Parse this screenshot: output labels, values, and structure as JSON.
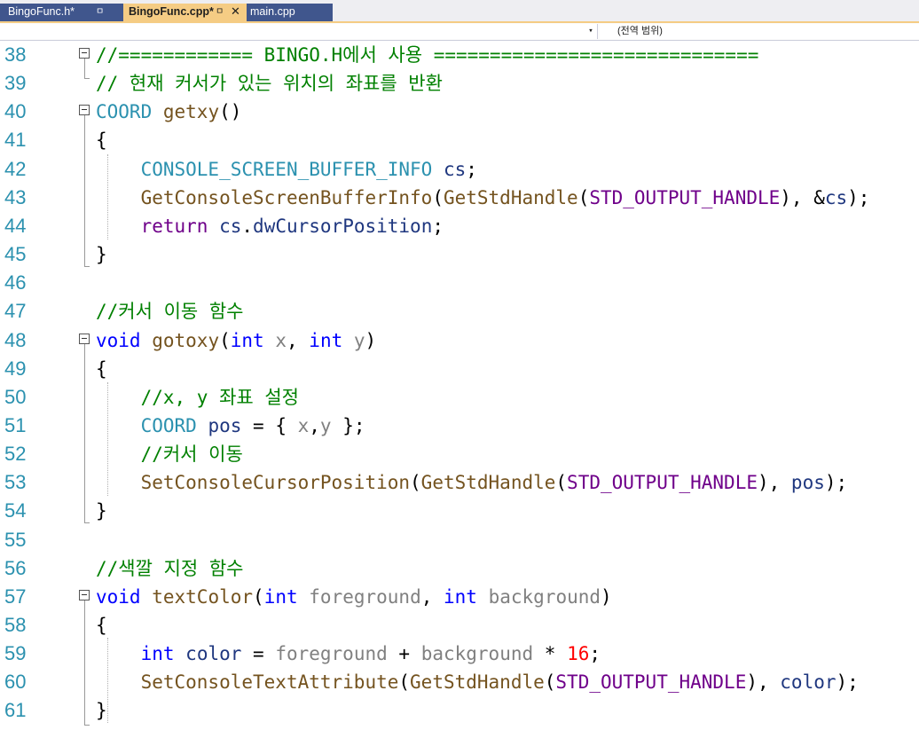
{
  "tabs": [
    {
      "label": "BingoFunc.h*",
      "pin": "ㅁ"
    },
    {
      "label": "BingoFunc.cpp*",
      "pin": "ㅁ",
      "close": "✕"
    },
    {
      "label": "main.cpp"
    }
  ],
  "navbar": {
    "dropdown_arrow": "▾",
    "scope_label": "(전역 범위)"
  },
  "editor": {
    "lines": [
      {
        "n": "38",
        "tokens": [
          {
            "t": "//============ BINGO.H에서 사용 =============================",
            "c": "cm"
          }
        ]
      },
      {
        "n": "39",
        "tokens": [
          {
            "t": "// 현재 커서가 있는 위치의 좌표를 반환",
            "c": "cm"
          }
        ]
      },
      {
        "n": "40",
        "tokens": [
          {
            "t": "COORD",
            "c": "ty"
          },
          {
            "t": " "
          },
          {
            "t": "getxy",
            "c": "fn"
          },
          {
            "t": "()"
          }
        ]
      },
      {
        "n": "41",
        "tokens": [
          {
            "t": "{"
          }
        ]
      },
      {
        "n": "42",
        "tokens": [
          {
            "t": "    "
          },
          {
            "t": "CONSOLE_SCREEN_BUFFER_INFO",
            "c": "ty"
          },
          {
            "t": " "
          },
          {
            "t": "cs",
            "c": "vr"
          },
          {
            "t": ";"
          }
        ]
      },
      {
        "n": "43",
        "tokens": [
          {
            "t": "    "
          },
          {
            "t": "GetConsoleScreenBufferInfo",
            "c": "fn"
          },
          {
            "t": "("
          },
          {
            "t": "GetStdHandle",
            "c": "fn"
          },
          {
            "t": "("
          },
          {
            "t": "STD_OUTPUT_HANDLE",
            "c": "mc"
          },
          {
            "t": "), &"
          },
          {
            "t": "cs",
            "c": "vr"
          },
          {
            "t": ");"
          }
        ]
      },
      {
        "n": "44",
        "tokens": [
          {
            "t": "    "
          },
          {
            "t": "return",
            "c": "mc"
          },
          {
            "t": " "
          },
          {
            "t": "cs",
            "c": "vr"
          },
          {
            "t": "."
          },
          {
            "t": "dwCursorPosition",
            "c": "vr"
          },
          {
            "t": ";"
          }
        ]
      },
      {
        "n": "45",
        "tokens": [
          {
            "t": "}"
          }
        ]
      },
      {
        "n": "46",
        "tokens": []
      },
      {
        "n": "47",
        "tokens": [
          {
            "t": "//커서 이동 함수",
            "c": "cm"
          }
        ]
      },
      {
        "n": "48",
        "tokens": [
          {
            "t": "void",
            "c": "kw"
          },
          {
            "t": " "
          },
          {
            "t": "gotoxy",
            "c": "fn"
          },
          {
            "t": "("
          },
          {
            "t": "int",
            "c": "kw"
          },
          {
            "t": " "
          },
          {
            "t": "x",
            "c": "pm"
          },
          {
            "t": ", "
          },
          {
            "t": "int",
            "c": "kw"
          },
          {
            "t": " "
          },
          {
            "t": "y",
            "c": "pm"
          },
          {
            "t": ")"
          }
        ]
      },
      {
        "n": "49",
        "tokens": [
          {
            "t": "{"
          }
        ]
      },
      {
        "n": "50",
        "tokens": [
          {
            "t": "    "
          },
          {
            "t": "//x, y 좌표 설정",
            "c": "cm"
          }
        ]
      },
      {
        "n": "51",
        "tokens": [
          {
            "t": "    "
          },
          {
            "t": "COORD",
            "c": "ty"
          },
          {
            "t": " "
          },
          {
            "t": "pos",
            "c": "vr"
          },
          {
            "t": " = { "
          },
          {
            "t": "x",
            "c": "pm"
          },
          {
            "t": ","
          },
          {
            "t": "y",
            "c": "pm"
          },
          {
            "t": " };"
          }
        ]
      },
      {
        "n": "52",
        "tokens": [
          {
            "t": "    "
          },
          {
            "t": "//커서 이동",
            "c": "cm"
          }
        ]
      },
      {
        "n": "53",
        "tokens": [
          {
            "t": "    "
          },
          {
            "t": "SetConsoleCursorPosition",
            "c": "fn"
          },
          {
            "t": "("
          },
          {
            "t": "GetStdHandle",
            "c": "fn"
          },
          {
            "t": "("
          },
          {
            "t": "STD_OUTPUT_HANDLE",
            "c": "mc"
          },
          {
            "t": "), "
          },
          {
            "t": "pos",
            "c": "vr"
          },
          {
            "t": ");"
          }
        ]
      },
      {
        "n": "54",
        "tokens": [
          {
            "t": "}"
          }
        ]
      },
      {
        "n": "55",
        "tokens": []
      },
      {
        "n": "56",
        "tokens": [
          {
            "t": "//색깔 지정 함수",
            "c": "cm"
          }
        ]
      },
      {
        "n": "57",
        "tokens": [
          {
            "t": "void",
            "c": "kw"
          },
          {
            "t": " "
          },
          {
            "t": "textColor",
            "c": "fn"
          },
          {
            "t": "("
          },
          {
            "t": "int",
            "c": "kw"
          },
          {
            "t": " "
          },
          {
            "t": "foreground",
            "c": "pm"
          },
          {
            "t": ", "
          },
          {
            "t": "int",
            "c": "kw"
          },
          {
            "t": " "
          },
          {
            "t": "background",
            "c": "pm"
          },
          {
            "t": ")"
          }
        ]
      },
      {
        "n": "58",
        "tokens": [
          {
            "t": "{"
          }
        ]
      },
      {
        "n": "59",
        "tokens": [
          {
            "t": "    "
          },
          {
            "t": "int",
            "c": "kw"
          },
          {
            "t": " "
          },
          {
            "t": "color",
            "c": "vr"
          },
          {
            "t": " = "
          },
          {
            "t": "foreground",
            "c": "pm"
          },
          {
            "t": " + "
          },
          {
            "t": "background",
            "c": "pm"
          },
          {
            "t": " * "
          },
          {
            "t": "16",
            "c": "nm"
          },
          {
            "t": ";"
          }
        ]
      },
      {
        "n": "60",
        "tokens": [
          {
            "t": "    "
          },
          {
            "t": "SetConsoleTextAttribute",
            "c": "fn"
          },
          {
            "t": "("
          },
          {
            "t": "GetStdHandle",
            "c": "fn"
          },
          {
            "t": "("
          },
          {
            "t": "STD_OUTPUT_HANDLE",
            "c": "mc"
          },
          {
            "t": "), "
          },
          {
            "t": "color",
            "c": "vr"
          },
          {
            "t": ");"
          }
        ]
      },
      {
        "n": "61",
        "tokens": [
          {
            "t": "}"
          }
        ]
      }
    ]
  },
  "colors": {
    "tab_active": "#f5cc84",
    "tab_inactive": "#40568d",
    "line_number": "#2b91af",
    "comment": "#008000",
    "keyword": "#0000ff",
    "type": "#2b91af",
    "function": "#74531f",
    "macro": "#6f008a",
    "parameter": "#808080",
    "local_variable": "#1f377f",
    "number": "#ff0000"
  }
}
